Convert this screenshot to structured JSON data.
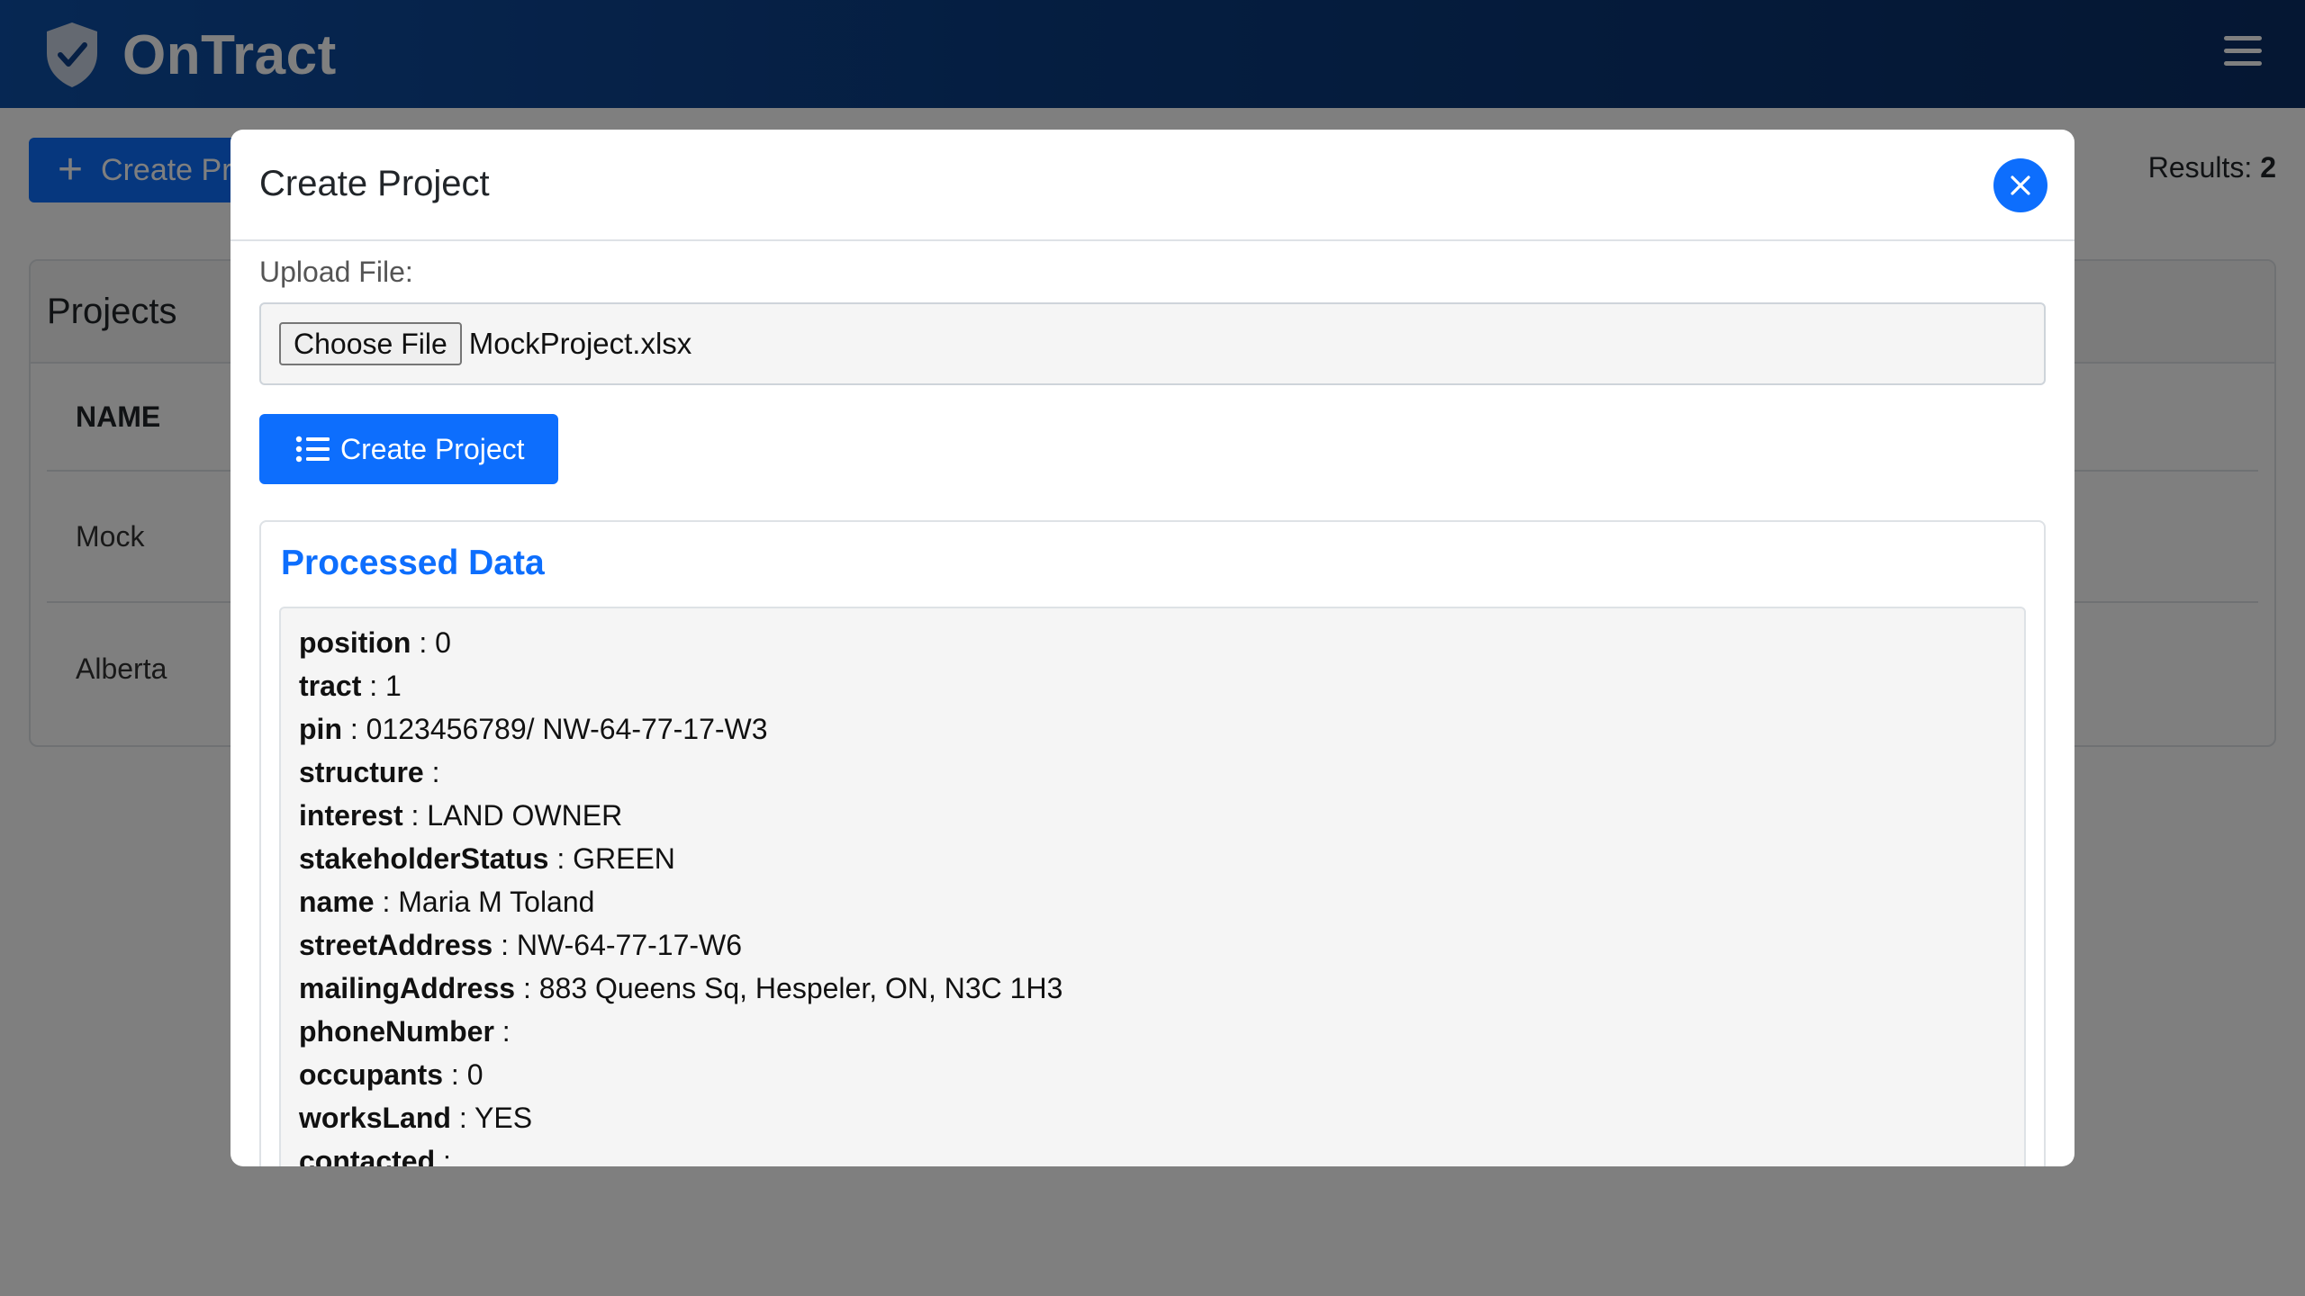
{
  "app": {
    "name": "OnTract"
  },
  "toolbar": {
    "create_label": "Create Pr",
    "results_label": "Results:",
    "results_count": "2"
  },
  "projects": {
    "title": "Projects",
    "column_name": "NAME",
    "rows": [
      "Mock",
      "Alberta"
    ]
  },
  "modal": {
    "title": "Create Project",
    "upload_label": "Upload File:",
    "choose_file_label": "Choose File",
    "file_name": "MockProject.xlsx",
    "create_button_label": "Create Project",
    "processed_title": "Processed Data",
    "fields": [
      {
        "key": "position",
        "value": "0"
      },
      {
        "key": "tract",
        "value": "1"
      },
      {
        "key": "pin",
        "value": "0123456789/ NW-64-77-17-W3"
      },
      {
        "key": "structure",
        "value": ""
      },
      {
        "key": "interest",
        "value": "LAND OWNER"
      },
      {
        "key": "stakeholderStatus",
        "value": "GREEN"
      },
      {
        "key": "name",
        "value": "Maria M Toland"
      },
      {
        "key": "streetAddress",
        "value": "NW-64-77-17-W6"
      },
      {
        "key": "mailingAddress",
        "value": "883 Queens Sq, Hespeler, ON, N3C 1H3"
      },
      {
        "key": "phoneNumber",
        "value": ""
      },
      {
        "key": "occupants",
        "value": "0"
      },
      {
        "key": "worksLand",
        "value": "YES"
      },
      {
        "key": "contacted",
        "value": ""
      }
    ]
  },
  "colors": {
    "primary": "#0d6efd",
    "header_dark": "#0a2e66",
    "header_light": "#0d4fa6"
  },
  "icons": [
    "shield-check-icon",
    "hamburger-menu-icon",
    "plus-icon",
    "close-icon",
    "list-icon"
  ]
}
